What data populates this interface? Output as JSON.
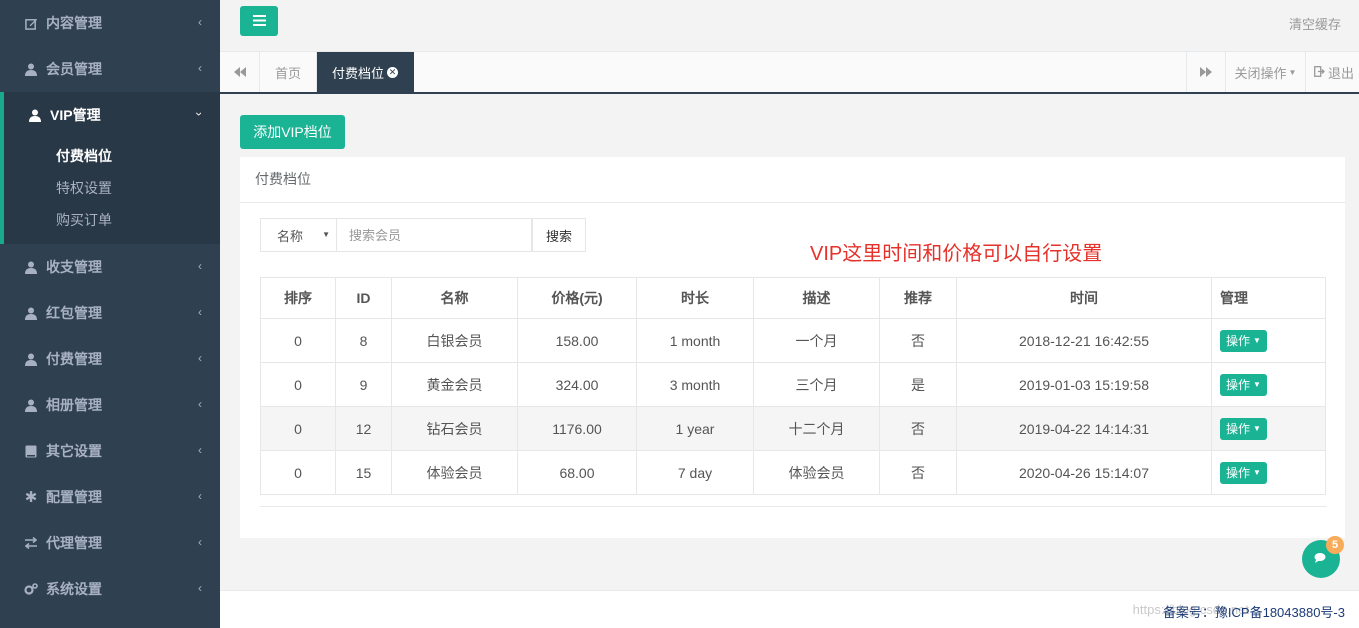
{
  "sidebar": {
    "items": [
      {
        "label": "内容管理",
        "icon": "edit-icon"
      },
      {
        "label": "会员管理",
        "icon": "user-icon"
      },
      {
        "label": "VIP管理",
        "icon": "user-icon",
        "expanded": true
      },
      {
        "label": "收支管理",
        "icon": "user-icon"
      },
      {
        "label": "红包管理",
        "icon": "user-icon"
      },
      {
        "label": "付费管理",
        "icon": "user-icon"
      },
      {
        "label": "相册管理",
        "icon": "user-icon"
      },
      {
        "label": "其它设置",
        "icon": "book-icon"
      },
      {
        "label": "配置管理",
        "icon": "asterisk-icon"
      },
      {
        "label": "代理管理",
        "icon": "exchange-icon"
      },
      {
        "label": "系统设置",
        "icon": "gears-icon"
      }
    ],
    "vip_submenu": [
      "付费档位",
      "特权设置",
      "购买订单"
    ],
    "active_sub": "付费档位"
  },
  "topbar": {
    "clear_cache": "清空缓存"
  },
  "tabs": {
    "home": "首页",
    "active": "付费档位",
    "close_ops": "关闭操作",
    "logout": "退出"
  },
  "main": {
    "add_button": "添加VIP档位",
    "panel_title": "付费档位",
    "search": {
      "field_selected": "名称",
      "placeholder": "搜索会员",
      "button": "搜索"
    },
    "annotation": "VIP这里时间和价格可以自行设置",
    "table": {
      "headers": [
        "排序",
        "ID",
        "名称",
        "价格(元)",
        "时长",
        "描述",
        "推荐",
        "时间",
        "管理"
      ],
      "rows": [
        {
          "order": "0",
          "id": "8",
          "name": "白银会员",
          "price": "158.00",
          "duration": "1 month",
          "desc": "一个月",
          "recommend": "否",
          "time": "2018-12-21 16:42:55",
          "action": "操作"
        },
        {
          "order": "0",
          "id": "9",
          "name": "黄金会员",
          "price": "324.00",
          "duration": "3 month",
          "desc": "三个月",
          "recommend": "是",
          "time": "2019-01-03 15:19:58",
          "action": "操作"
        },
        {
          "order": "0",
          "id": "12",
          "name": "钻石会员",
          "price": "1176.00",
          "duration": "1 year",
          "desc": "十二个月",
          "recommend": "否",
          "time": "2019-04-22 14:14:31",
          "action": "操作"
        },
        {
          "order": "0",
          "id": "15",
          "name": "体验会员",
          "price": "68.00",
          "duration": "7 day",
          "desc": "体验会员",
          "recommend": "否",
          "time": "2020-04-26 15:14:07",
          "action": "操作"
        }
      ]
    }
  },
  "footer": {
    "icp": "备案号：豫ICP备18043880号-3",
    "watermark": "https://blog.csdn.net"
  },
  "chat": {
    "badge": "5"
  },
  "colors": {
    "accent": "#1ab394",
    "sidebar_bg": "#2f4050",
    "annotation": "#e6312a"
  }
}
